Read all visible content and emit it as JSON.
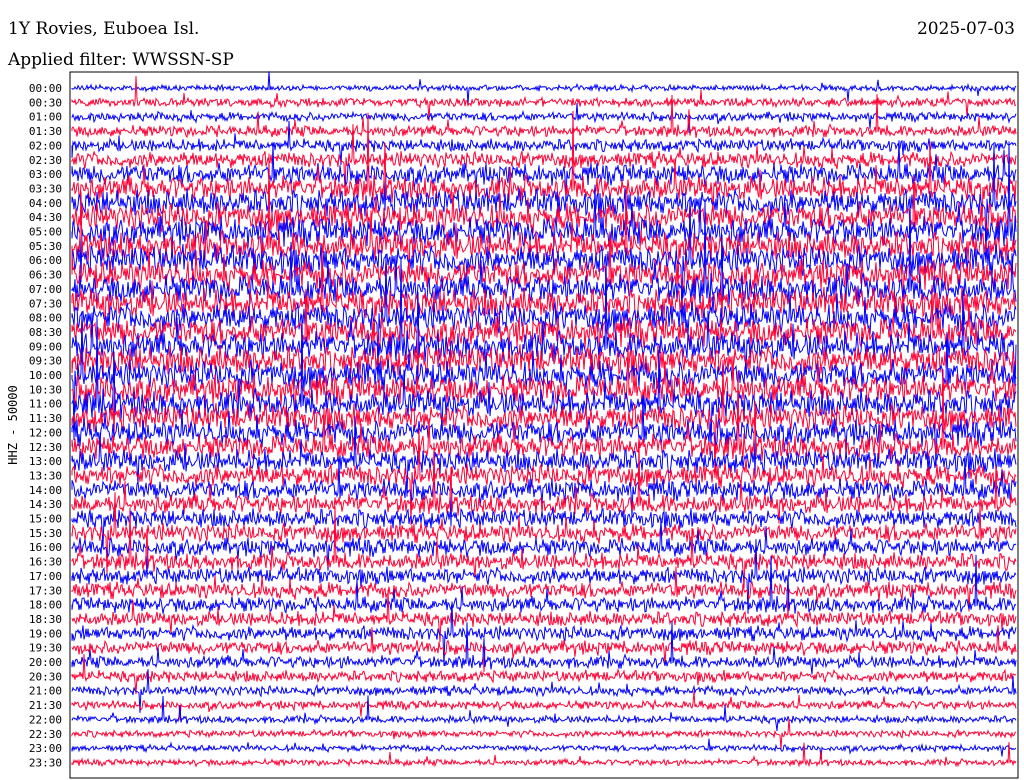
{
  "header": {
    "title": "1Y Rovies, Euboea Isl.",
    "date": "2025-07-03",
    "filter": "Applied filter: WWSSN-SP"
  },
  "chart_data": {
    "type": "line",
    "title": "1Y Rovies, Euboea Isl.",
    "ylabel": "HHZ - 50000",
    "colors": [
      "#0000ff",
      "#ff0033"
    ],
    "grid": false,
    "lines": [
      {
        "label": "00:00",
        "amplitude": 1.0,
        "color": "#0000ff"
      },
      {
        "label": "00:30",
        "amplitude": 1.5,
        "color": "#ff0033"
      },
      {
        "label": "01:00",
        "amplitude": 1.6,
        "color": "#0000ff"
      },
      {
        "label": "01:30",
        "amplitude": 2.0,
        "color": "#ff0033"
      },
      {
        "label": "02:00",
        "amplitude": 2.2,
        "color": "#0000ff"
      },
      {
        "label": "02:30",
        "amplitude": 2.8,
        "color": "#ff0033"
      },
      {
        "label": "03:00",
        "amplitude": 3.6,
        "color": "#0000ff"
      },
      {
        "label": "03:30",
        "amplitude": 4.2,
        "color": "#ff0033"
      },
      {
        "label": "04:00",
        "amplitude": 4.6,
        "color": "#0000ff"
      },
      {
        "label": "04:30",
        "amplitude": 4.8,
        "color": "#ff0033"
      },
      {
        "label": "05:00",
        "amplitude": 5.0,
        "color": "#0000ff"
      },
      {
        "label": "05:30",
        "amplitude": 5.0,
        "color": "#ff0033"
      },
      {
        "label": "06:00",
        "amplitude": 5.0,
        "color": "#0000ff"
      },
      {
        "label": "06:30",
        "amplitude": 5.0,
        "color": "#ff0033"
      },
      {
        "label": "07:00",
        "amplitude": 5.0,
        "color": "#0000ff"
      },
      {
        "label": "07:30",
        "amplitude": 5.0,
        "color": "#ff0033"
      },
      {
        "label": "08:00",
        "amplitude": 5.0,
        "color": "#0000ff"
      },
      {
        "label": "08:30",
        "amplitude": 5.0,
        "color": "#ff0033"
      },
      {
        "label": "09:00",
        "amplitude": 5.0,
        "color": "#0000ff"
      },
      {
        "label": "09:30",
        "amplitude": 5.0,
        "color": "#ff0033"
      },
      {
        "label": "10:00",
        "amplitude": 5.0,
        "color": "#0000ff"
      },
      {
        "label": "10:30",
        "amplitude": 5.0,
        "color": "#ff0033"
      },
      {
        "label": "11:00",
        "amplitude": 4.8,
        "color": "#0000ff"
      },
      {
        "label": "11:30",
        "amplitude": 4.6,
        "color": "#ff0033"
      },
      {
        "label": "12:00",
        "amplitude": 4.4,
        "color": "#0000ff"
      },
      {
        "label": "12:30",
        "amplitude": 4.2,
        "color": "#ff0033"
      },
      {
        "label": "13:00",
        "amplitude": 4.0,
        "color": "#0000ff"
      },
      {
        "label": "13:30",
        "amplitude": 3.8,
        "color": "#ff0033"
      },
      {
        "label": "14:00",
        "amplitude": 3.6,
        "color": "#0000ff"
      },
      {
        "label": "14:30",
        "amplitude": 3.4,
        "color": "#ff0033"
      },
      {
        "label": "15:00",
        "amplitude": 3.3,
        "color": "#0000ff"
      },
      {
        "label": "15:30",
        "amplitude": 3.2,
        "color": "#ff0033"
      },
      {
        "label": "16:00",
        "amplitude": 3.1,
        "color": "#0000ff"
      },
      {
        "label": "16:30",
        "amplitude": 3.0,
        "color": "#ff0033"
      },
      {
        "label": "17:00",
        "amplitude": 2.9,
        "color": "#0000ff"
      },
      {
        "label": "17:30",
        "amplitude": 2.8,
        "color": "#ff0033"
      },
      {
        "label": "18:00",
        "amplitude": 2.7,
        "color": "#0000ff"
      },
      {
        "label": "18:30",
        "amplitude": 2.6,
        "color": "#ff0033"
      },
      {
        "label": "19:00",
        "amplitude": 2.5,
        "color": "#0000ff"
      },
      {
        "label": "19:30",
        "amplitude": 2.4,
        "color": "#ff0033"
      },
      {
        "label": "20:00",
        "amplitude": 2.2,
        "color": "#0000ff"
      },
      {
        "label": "20:30",
        "amplitude": 2.0,
        "color": "#ff0033"
      },
      {
        "label": "21:00",
        "amplitude": 1.7,
        "color": "#0000ff"
      },
      {
        "label": "21:30",
        "amplitude": 1.5,
        "color": "#ff0033"
      },
      {
        "label": "22:00",
        "amplitude": 1.3,
        "color": "#0000ff"
      },
      {
        "label": "22:30",
        "amplitude": 1.2,
        "color": "#ff0033"
      },
      {
        "label": "23:00",
        "amplitude": 1.1,
        "color": "#0000ff"
      },
      {
        "label": "23:30",
        "amplitude": 1.1,
        "color": "#ff0033"
      }
    ]
  }
}
